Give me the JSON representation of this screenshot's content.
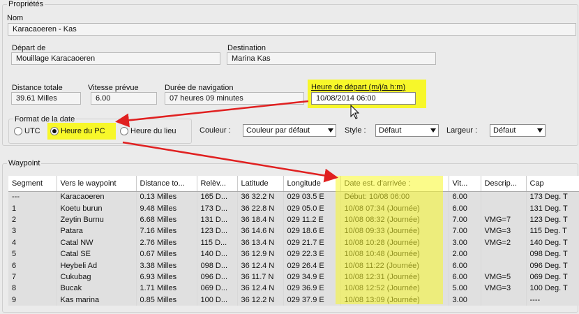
{
  "header": {
    "title": "Propriétés"
  },
  "name": {
    "label": "Nom",
    "value": "Karacaoeren - Kas"
  },
  "departure": {
    "label": "Départ de",
    "value": "Mouillage Karacaoeren"
  },
  "destination": {
    "label": "Destination",
    "value": "Marina Kas"
  },
  "stats": {
    "distance_label": "Distance totale",
    "distance_value": "39.61 Milles",
    "speed_label": "Vitesse prévue",
    "speed_value": "6.00",
    "duration_label": "Durée de navigation",
    "duration_value": "07 heures  09 minutes",
    "departure_time_label": "Heure de départ (m/j/a h:m)",
    "departure_time_value": "10/08/2014 06:00"
  },
  "date_format": {
    "title": "Format de la date",
    "options": [
      "UTC",
      "Heure du PC",
      "Heure du lieu"
    ],
    "selected": "Heure du PC"
  },
  "style_controls": {
    "color_label": "Couleur :",
    "color_value": "Couleur par défaut",
    "style_label": "Style :",
    "style_value": "Défaut",
    "width_label": "Largeur :",
    "width_value": "Défaut"
  },
  "waypoint": {
    "title": "Waypoint",
    "columns": [
      "Segment",
      "Vers le waypoint",
      "Distance to...",
      "Relèv...",
      "Latitude",
      "Longitude",
      "Date est. d'arrivée :",
      "Vit...",
      "Descrip...",
      "Cap"
    ],
    "rows": [
      [
        "---",
        "Karacaoeren",
        "0.13 Milles",
        "165 D...",
        "36 32.2 N",
        "029 03.5 E",
        "Début:  10/08 06:00",
        "6.00",
        "",
        "173 Deg. T"
      ],
      [
        "1",
        "Koetu burun",
        "9.48 Milles",
        "173 D...",
        "36 22.8 N",
        "029 05.0 E",
        "10/08 07:34  (Journée)",
        "6.00",
        "",
        "131 Deg. T"
      ],
      [
        "2",
        "Zeytin Burnu",
        "6.68 Milles",
        "131 D...",
        "36 18.4 N",
        "029 11.2 E",
        "10/08 08:32  (Journée)",
        "7.00",
        "VMG=7",
        "123 Deg. T"
      ],
      [
        "3",
        "Patara",
        "7.16 Milles",
        "123 D...",
        "36 14.6 N",
        "029 18.6 E",
        "10/08 09:33  (Journée)",
        "7.00",
        "VMG=3",
        "115 Deg. T"
      ],
      [
        "4",
        "Catal NW",
        "2.76 Milles",
        "115 D...",
        "36 13.4 N",
        "029 21.7 E",
        "10/08 10:28  (Journée)",
        "3.00",
        "VMG=2",
        "140 Deg. T"
      ],
      [
        "5",
        "Catal SE",
        "0.67 Milles",
        "140 D...",
        "36 12.9 N",
        "029 22.3 E",
        "10/08 10:48  (Journée)",
        "2.00",
        "",
        "098 Deg. T"
      ],
      [
        "6",
        "Heybeli Ad",
        "3.38 Milles",
        "098 D...",
        "36 12.4 N",
        "029 26.4 E",
        "10/08 11:22  (Journée)",
        "6.00",
        "",
        "096 Deg. T"
      ],
      [
        "7",
        "Cukubag",
        "6.93 Milles",
        "096 D...",
        "36 11.7 N",
        "029 34.9 E",
        "10/08 12:31  (Journée)",
        "6.00",
        "VMG=5",
        "069 Deg. T"
      ],
      [
        "8",
        "Bucak",
        "1.71 Milles",
        "069 D...",
        "36 12.4 N",
        "029 36.9 E",
        "10/08 12:52  (Journée)",
        "5.00",
        "VMG=3",
        "100 Deg. T"
      ],
      [
        "9",
        "Kas marina",
        "0.85 Milles",
        "100 D...",
        "36 12.2 N",
        "029 37.9 E",
        "10/08 13:09  (Journée)",
        "3.00",
        "",
        "----"
      ]
    ]
  },
  "colors": {
    "highlight": "#f7f72a",
    "arrow": "#e02020"
  }
}
